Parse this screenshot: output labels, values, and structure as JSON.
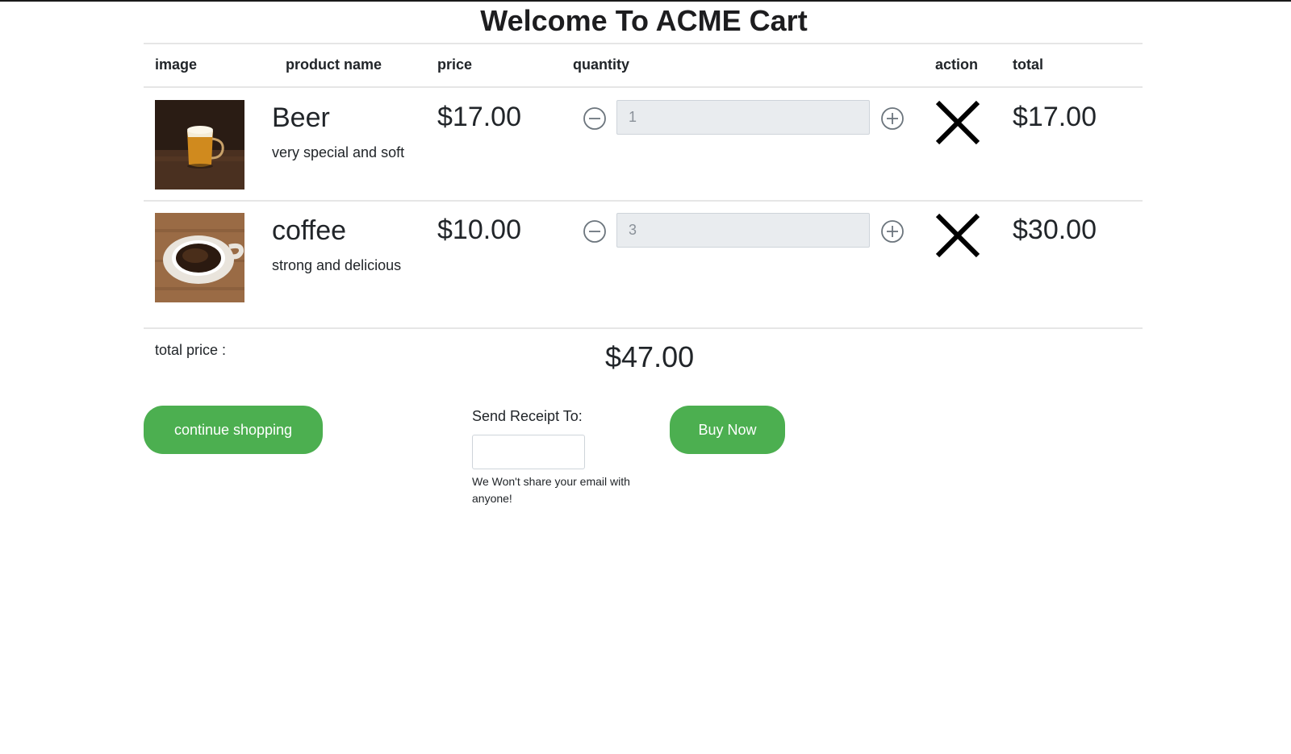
{
  "header": {
    "title": "Welcome To ACME Cart"
  },
  "table": {
    "columns": {
      "image": "image",
      "product_name": "product name",
      "price": "price",
      "quantity": "quantity",
      "action": "action",
      "total": "total"
    },
    "rows": [
      {
        "name": "Beer",
        "description": "very special and soft",
        "price": "$17.00",
        "quantity": "1",
        "total": "$17.00",
        "image_icon": "beer-mug-image"
      },
      {
        "name": "coffee",
        "description": "strong and delicious",
        "price": "$10.00",
        "quantity": "3",
        "total": "$30.00",
        "image_icon": "coffee-cup-image"
      }
    ]
  },
  "summary": {
    "label": "total price :",
    "value": "$47.00"
  },
  "actions": {
    "continue_label": "continue shopping",
    "buy_label": "Buy Now"
  },
  "receipt": {
    "label": "Send Receipt To:",
    "value": "",
    "note": "We Won't share your email with anyone!"
  },
  "colors": {
    "accent": "#4caf50",
    "input_bg": "#e9ecef"
  },
  "icons": {
    "decrease": "minus-circle-icon",
    "increase": "plus-circle-icon",
    "remove": "x-icon"
  }
}
